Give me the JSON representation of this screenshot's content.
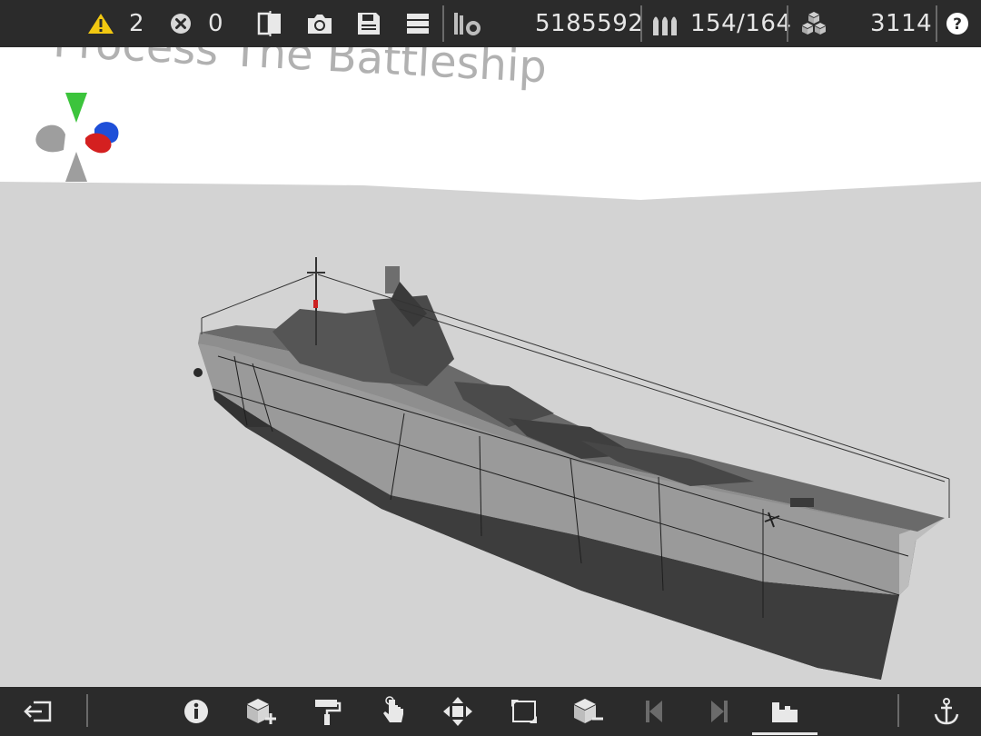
{
  "toolbar": {
    "warnings_count": "2",
    "errors_count": "0",
    "points": "5185592",
    "ammo": "154/164",
    "blocks": "3114"
  },
  "viewport": {
    "watermark_title": "Process The Battleship"
  },
  "colors": {
    "bar_bg": "#2b2b2b",
    "warning": "#f2c811",
    "gizmo_y": "#3cc43c",
    "gizmo_z": "#1e4fd8",
    "gizmo_x": "#d42020",
    "ground": "#d3d3d3"
  },
  "icons": {
    "top": [
      "warning-icon",
      "error-icon",
      "mirror-icon",
      "camera-icon",
      "save-icon",
      "list-icon",
      "weight-icon",
      "ammo-icon",
      "blocks-icon",
      "help-icon"
    ],
    "bottom": [
      "exit-icon",
      "info-icon",
      "add-block-icon",
      "paint-roller-icon",
      "touch-icon",
      "move-icon",
      "resize-icon",
      "remove-block-icon",
      "previous-icon",
      "next-icon",
      "build-mode-icon",
      "anchor-icon"
    ]
  }
}
